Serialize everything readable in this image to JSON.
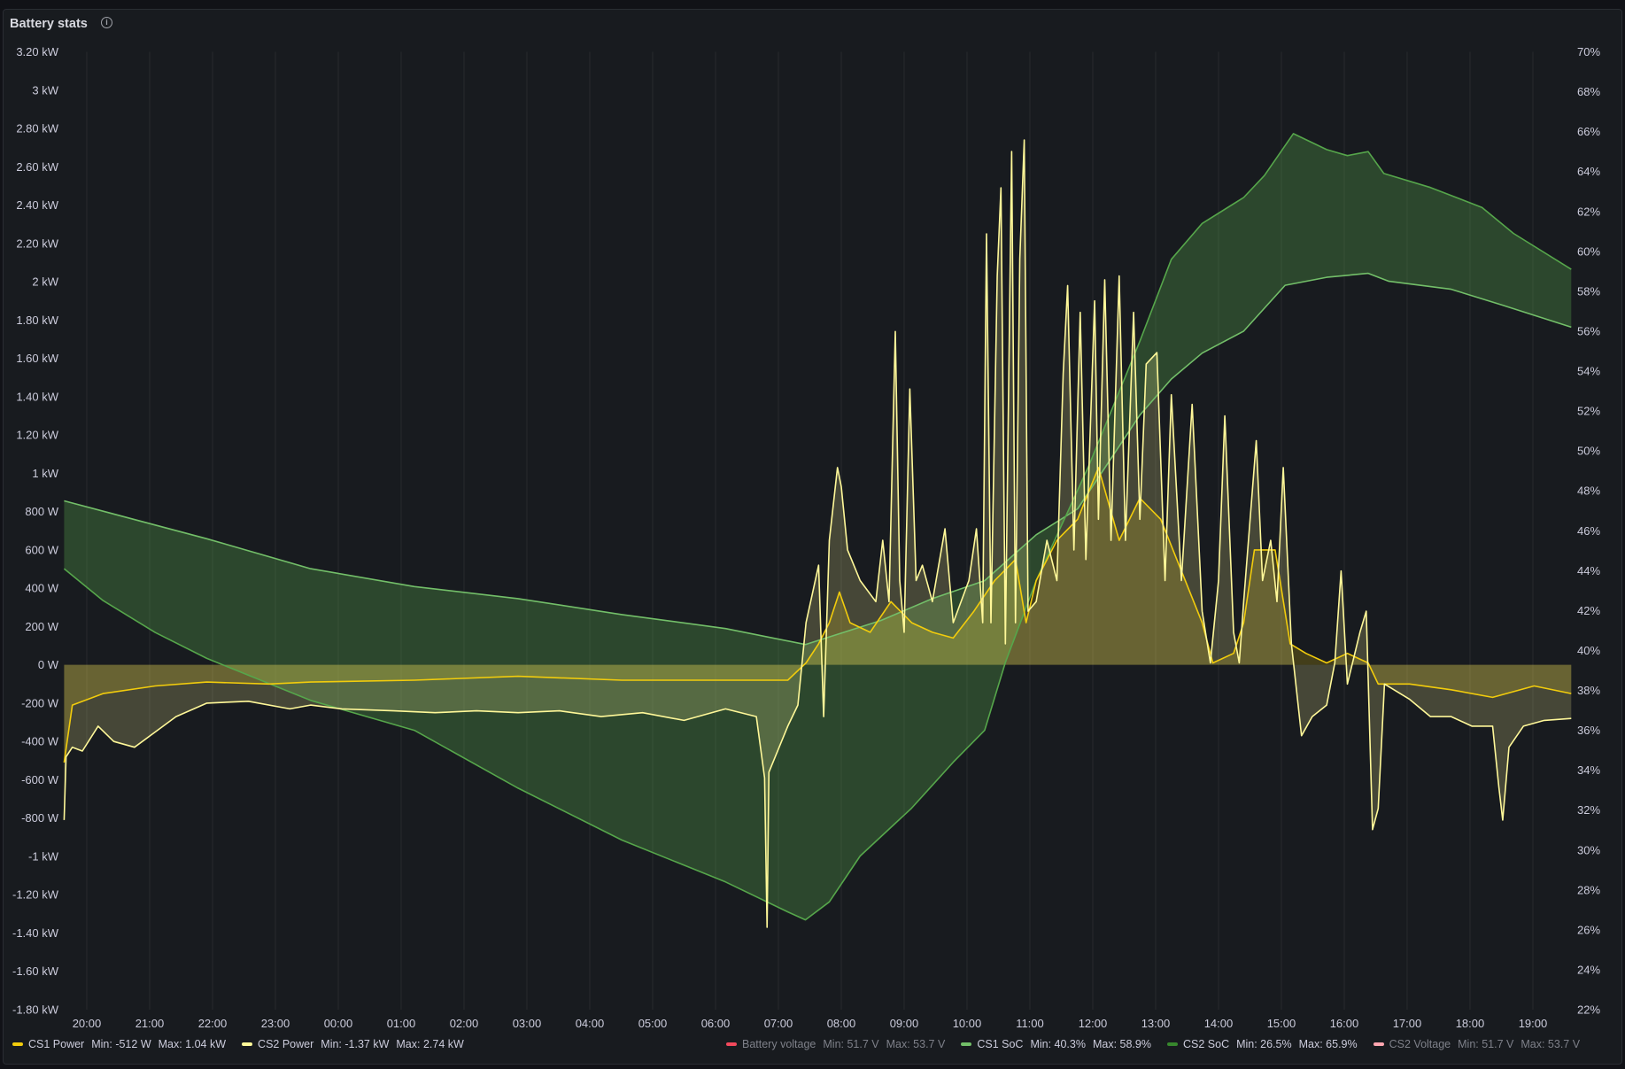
{
  "panel": {
    "title": "Battery stats",
    "info_icon": "info-icon"
  },
  "chart_data": {
    "type": "line",
    "time_unit": "hours since 20:00",
    "x_range": [
      -0.366,
      23.62
    ],
    "x_ticks": [
      "20:00",
      "21:00",
      "22:00",
      "23:00",
      "00:00",
      "01:00",
      "02:00",
      "03:00",
      "04:00",
      "05:00",
      "06:00",
      "07:00",
      "08:00",
      "09:00",
      "10:00",
      "11:00",
      "12:00",
      "13:00",
      "14:00",
      "15:00",
      "16:00",
      "17:00",
      "18:00",
      "19:00"
    ],
    "left_axis": {
      "unit": "W",
      "range": [
        -1800,
        3200
      ],
      "ticks": [
        "3.20 kW",
        "3 kW",
        "2.80 kW",
        "2.60 kW",
        "2.40 kW",
        "2.20 kW",
        "2 kW",
        "1.80 kW",
        "1.60 kW",
        "1.40 kW",
        "1.20 kW",
        "1 kW",
        "800 W",
        "600 W",
        "400 W",
        "200 W",
        "0 W",
        "-200 W",
        "-400 W",
        "-600 W",
        "-800 W",
        "-1 kW",
        "-1.20 kW",
        "-1.40 kW",
        "-1.60 kW",
        "-1.80 kW"
      ]
    },
    "right_axis": {
      "unit": "%",
      "range": [
        22,
        70
      ],
      "ticks": [
        "70%",
        "68%",
        "66%",
        "64%",
        "62%",
        "60%",
        "58%",
        "56%",
        "54%",
        "52%",
        "50%",
        "48%",
        "46%",
        "44%",
        "42%",
        "40%",
        "38%",
        "36%",
        "34%",
        "32%",
        "30%",
        "28%",
        "26%",
        "24%",
        "22%"
      ]
    },
    "series": [
      {
        "name": "CS1 Power",
        "axis": "left",
        "color": "#F2CC0C",
        "min": "Min: -512 W",
        "max": "Max: 1.04 kW",
        "points": [
          [
            -0.36,
            -510
          ],
          [
            -0.23,
            -210
          ],
          [
            0.26,
            -150
          ],
          [
            1.09,
            -110
          ],
          [
            1.91,
            -90
          ],
          [
            2.9,
            -100
          ],
          [
            3.56,
            -90
          ],
          [
            5.21,
            -80
          ],
          [
            6.86,
            -60
          ],
          [
            8.51,
            -80
          ],
          [
            10.16,
            -80
          ],
          [
            11.15,
            -80
          ],
          [
            11.44,
            10
          ],
          [
            11.64,
            110
          ],
          [
            11.81,
            220
          ],
          [
            11.97,
            380
          ],
          [
            12.14,
            220
          ],
          [
            12.46,
            170
          ],
          [
            12.79,
            330
          ],
          [
            13.12,
            220
          ],
          [
            13.45,
            170
          ],
          [
            13.78,
            140
          ],
          [
            14.11,
            280
          ],
          [
            14.44,
            440
          ],
          [
            14.77,
            550
          ],
          [
            14.94,
            220
          ],
          [
            15.1,
            440
          ],
          [
            15.43,
            650
          ],
          [
            15.76,
            760
          ],
          [
            16.09,
            1030
          ],
          [
            16.42,
            650
          ],
          [
            16.75,
            870
          ],
          [
            17.08,
            760
          ],
          [
            17.41,
            490
          ],
          [
            17.74,
            220
          ],
          [
            17.91,
            10
          ],
          [
            18.24,
            60
          ],
          [
            18.4,
            220
          ],
          [
            18.57,
            600
          ],
          [
            18.9,
            600
          ],
          [
            19.14,
            110
          ],
          [
            19.39,
            60
          ],
          [
            19.72,
            10
          ],
          [
            20.05,
            60
          ],
          [
            20.38,
            10
          ],
          [
            20.54,
            -100
          ],
          [
            21.04,
            -100
          ],
          [
            21.7,
            -130
          ],
          [
            22.36,
            -170
          ],
          [
            23.02,
            -110
          ],
          [
            23.61,
            -150
          ]
        ]
      },
      {
        "name": "CS2 Power",
        "axis": "left",
        "color": "#FFF899",
        "min": "Min: -1.37 kW",
        "max": "Max: 2.74 kW",
        "points": [
          [
            -0.36,
            -810
          ],
          [
            -0.33,
            -480
          ],
          [
            -0.23,
            -430
          ],
          [
            -0.07,
            -450
          ],
          [
            0.18,
            -320
          ],
          [
            0.43,
            -400
          ],
          [
            0.76,
            -430
          ],
          [
            1.09,
            -350
          ],
          [
            1.42,
            -270
          ],
          [
            1.91,
            -200
          ],
          [
            2.57,
            -190
          ],
          [
            3.23,
            -230
          ],
          [
            3.56,
            -210
          ],
          [
            4.06,
            -230
          ],
          [
            4.88,
            -240
          ],
          [
            5.54,
            -250
          ],
          [
            6.2,
            -240
          ],
          [
            6.86,
            -250
          ],
          [
            7.52,
            -240
          ],
          [
            8.18,
            -270
          ],
          [
            8.84,
            -250
          ],
          [
            9.5,
            -290
          ],
          [
            10.16,
            -230
          ],
          [
            10.65,
            -270
          ],
          [
            10.78,
            -590
          ],
          [
            10.82,
            -1370
          ],
          [
            10.85,
            -560
          ],
          [
            11.15,
            -320
          ],
          [
            11.31,
            -210
          ],
          [
            11.44,
            220
          ],
          [
            11.64,
            520
          ],
          [
            11.72,
            -270
          ],
          [
            11.81,
            650
          ],
          [
            11.94,
            1030
          ],
          [
            12.0,
            930
          ],
          [
            12.1,
            600
          ],
          [
            12.3,
            440
          ],
          [
            12.55,
            330
          ],
          [
            12.66,
            650
          ],
          [
            12.76,
            330
          ],
          [
            12.86,
            1740
          ],
          [
            12.93,
            440
          ],
          [
            13.0,
            170
          ],
          [
            13.09,
            1440
          ],
          [
            13.19,
            440
          ],
          [
            13.29,
            520
          ],
          [
            13.45,
            330
          ],
          [
            13.65,
            710
          ],
          [
            13.78,
            220
          ],
          [
            14.03,
            440
          ],
          [
            14.15,
            710
          ],
          [
            14.25,
            220
          ],
          [
            14.31,
            2250
          ],
          [
            14.38,
            220
          ],
          [
            14.48,
            2030
          ],
          [
            14.54,
            2490
          ],
          [
            14.61,
            110
          ],
          [
            14.71,
            2680
          ],
          [
            14.77,
            220
          ],
          [
            14.84,
            2120
          ],
          [
            14.91,
            2740
          ],
          [
            14.97,
            280
          ],
          [
            15.1,
            330
          ],
          [
            15.27,
            650
          ],
          [
            15.43,
            440
          ],
          [
            15.53,
            1520
          ],
          [
            15.6,
            1980
          ],
          [
            15.7,
            600
          ],
          [
            15.8,
            1840
          ],
          [
            15.89,
            550
          ],
          [
            16.03,
            1900
          ],
          [
            16.09,
            760
          ],
          [
            16.19,
            2010
          ],
          [
            16.29,
            650
          ],
          [
            16.42,
            2030
          ],
          [
            16.52,
            650
          ],
          [
            16.65,
            1840
          ],
          [
            16.75,
            760
          ],
          [
            16.85,
            1570
          ],
          [
            17.02,
            1630
          ],
          [
            17.15,
            440
          ],
          [
            17.25,
            1410
          ],
          [
            17.41,
            440
          ],
          [
            17.58,
            1360
          ],
          [
            17.74,
            280
          ],
          [
            17.87,
            10
          ],
          [
            18.0,
            440
          ],
          [
            18.1,
            1300
          ],
          [
            18.24,
            170
          ],
          [
            18.33,
            10
          ],
          [
            18.4,
            330
          ],
          [
            18.6,
            1170
          ],
          [
            18.7,
            440
          ],
          [
            18.83,
            650
          ],
          [
            18.93,
            330
          ],
          [
            19.03,
            1030
          ],
          [
            19.16,
            110
          ],
          [
            19.32,
            -370
          ],
          [
            19.49,
            -270
          ],
          [
            19.72,
            -210
          ],
          [
            19.85,
            10
          ],
          [
            19.95,
            490
          ],
          [
            20.05,
            -100
          ],
          [
            20.25,
            170
          ],
          [
            20.35,
            280
          ],
          [
            20.45,
            -860
          ],
          [
            20.54,
            -750
          ],
          [
            20.64,
            -100
          ],
          [
            21.04,
            -180
          ],
          [
            21.37,
            -270
          ],
          [
            21.7,
            -270
          ],
          [
            22.03,
            -320
          ],
          [
            22.36,
            -320
          ],
          [
            22.46,
            -640
          ],
          [
            22.52,
            -810
          ],
          [
            22.62,
            -430
          ],
          [
            22.85,
            -320
          ],
          [
            23.18,
            -290
          ],
          [
            23.61,
            -280
          ]
        ]
      },
      {
        "name": "CS1 SoC",
        "axis": "right",
        "color": "#73BF69",
        "min": "Min: 40.3%",
        "max": "Max: 58.9%",
        "points": [
          [
            -0.36,
            47.5
          ],
          [
            1.91,
            45.6
          ],
          [
            3.56,
            44.1
          ],
          [
            5.21,
            43.2
          ],
          [
            6.86,
            42.6
          ],
          [
            8.51,
            41.8
          ],
          [
            10.16,
            41.1
          ],
          [
            11.43,
            40.3
          ],
          [
            12.63,
            41.5
          ],
          [
            13.45,
            42.6
          ],
          [
            14.28,
            43.5
          ],
          [
            15.1,
            45.8
          ],
          [
            15.76,
            47.1
          ],
          [
            16.75,
            51.8
          ],
          [
            17.25,
            53.6
          ],
          [
            17.74,
            54.9
          ],
          [
            18.4,
            56.0
          ],
          [
            19.06,
            58.3
          ],
          [
            19.72,
            58.7
          ],
          [
            20.38,
            58.9
          ],
          [
            20.71,
            58.5
          ],
          [
            21.7,
            58.1
          ],
          [
            22.52,
            57.3
          ],
          [
            23.61,
            56.2
          ]
        ]
      },
      {
        "name": "CS2 SoC",
        "axis": "right",
        "color": "#56A64B",
        "min": "Min: 26.5%",
        "max": "Max: 65.9%",
        "points": [
          [
            -0.36,
            44.1
          ],
          [
            0.26,
            42.5
          ],
          [
            1.09,
            40.9
          ],
          [
            1.91,
            39.6
          ],
          [
            3.56,
            37.5
          ],
          [
            5.21,
            36.0
          ],
          [
            6.86,
            33.1
          ],
          [
            8.51,
            30.5
          ],
          [
            10.16,
            28.4
          ],
          [
            11.15,
            26.9
          ],
          [
            11.43,
            26.5
          ],
          [
            11.81,
            27.4
          ],
          [
            12.3,
            29.7
          ],
          [
            13.12,
            32.1
          ],
          [
            13.78,
            34.4
          ],
          [
            14.28,
            36.0
          ],
          [
            14.61,
            39.4
          ],
          [
            15.1,
            43.5
          ],
          [
            15.93,
            49.2
          ],
          [
            16.75,
            55.5
          ],
          [
            17.25,
            59.6
          ],
          [
            17.74,
            61.4
          ],
          [
            18.4,
            62.7
          ],
          [
            18.73,
            63.8
          ],
          [
            19.19,
            65.9
          ],
          [
            19.72,
            65.1
          ],
          [
            20.05,
            64.8
          ],
          [
            20.38,
            65.0
          ],
          [
            20.63,
            63.9
          ],
          [
            21.37,
            63.2
          ],
          [
            22.19,
            62.2
          ],
          [
            22.69,
            60.9
          ],
          [
            23.61,
            59.1
          ]
        ]
      }
    ],
    "hidden_series": [
      {
        "name": "Battery voltage",
        "color": "#F2495C",
        "min": "Min: 51.7 V",
        "max": "Max: 53.7 V"
      },
      {
        "name": "CS2 Voltage",
        "color": "#FFA6B0",
        "min": "Min: 51.7 V",
        "max": "Max: 53.7 V"
      }
    ],
    "grid": "vertical",
    "legend_placement": "bottom"
  }
}
